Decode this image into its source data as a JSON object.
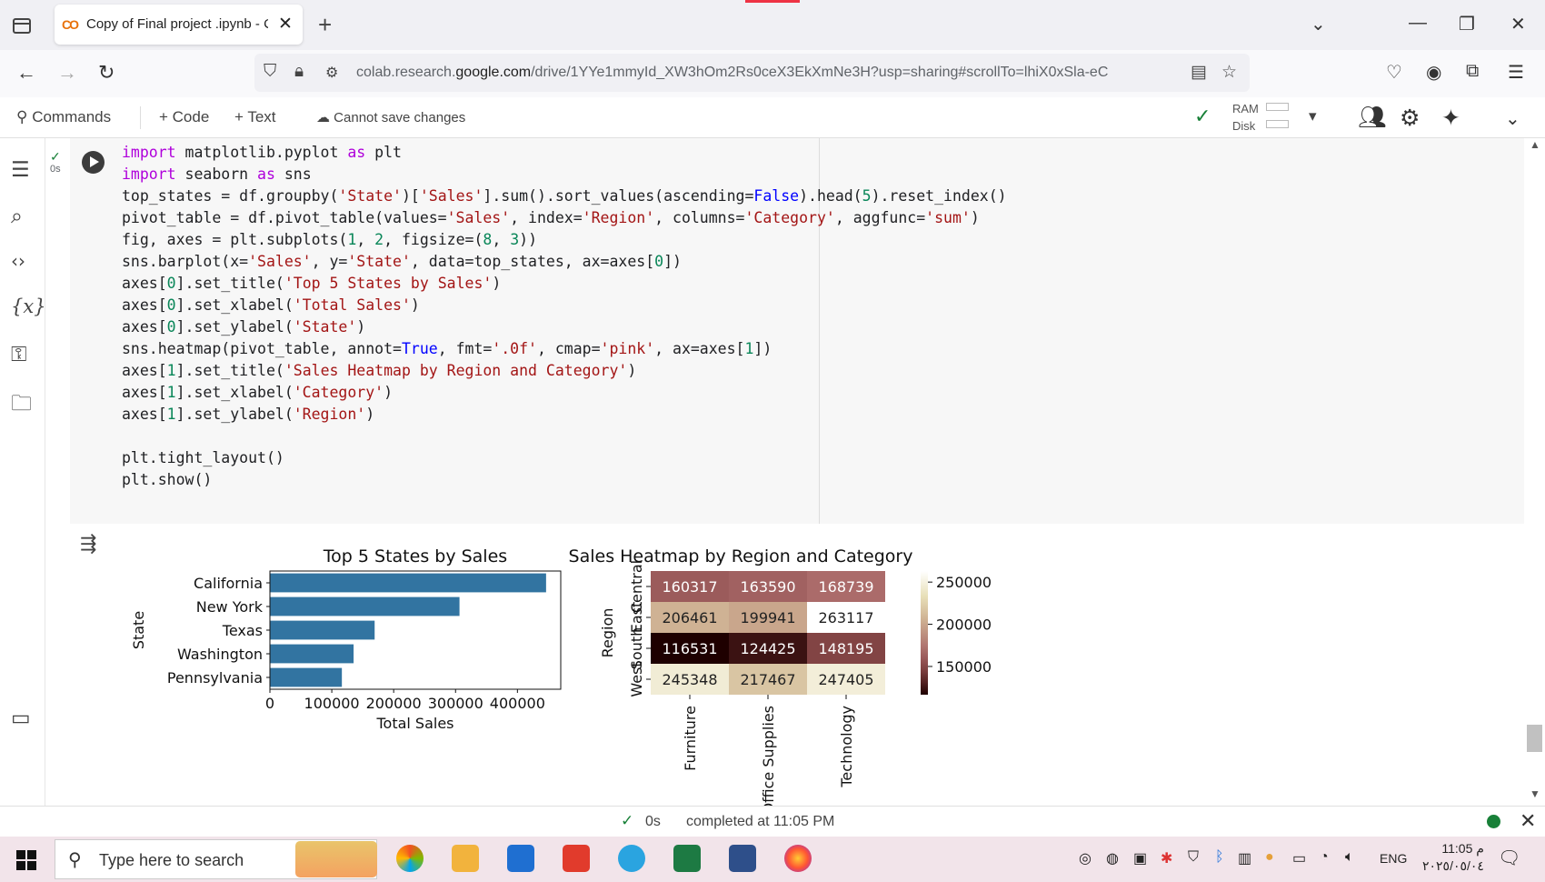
{
  "browser": {
    "tab_title": "Copy of Final project .ipynb - Co",
    "favicon": "CO",
    "url_prefix": "colab.research.",
    "url_domain": "google.com",
    "url_rest": "/drive/1YYe1mmyId_XW3hOm2Rs0ceX3EkXmNe3H?usp=sharing#scrollTo=lhiX0xSla-eC"
  },
  "toolbar": {
    "commands": "Commands",
    "code": "+ Code",
    "text": "+ Text",
    "cannot_save": "Cannot save changes",
    "ram": "RAM",
    "disk": "Disk"
  },
  "cell": {
    "exec_time": "0s",
    "code_lines": [
      "import matplotlib.pyplot as plt",
      "import seaborn as sns",
      "top_states = df.groupby('State')['Sales'].sum().sort_values(ascending=False).head(5).reset_index()",
      "pivot_table = df.pivot_table(values='Sales', index='Region', columns='Category', aggfunc='sum')",
      "fig, axes = plt.subplots(1, 2, figsize=(8, 3))",
      "sns.barplot(x='Sales', y='State', data=top_states, ax=axes[0])",
      "axes[0].set_title('Top 5 States by Sales')",
      "axes[0].set_xlabel('Total Sales')",
      "axes[0].set_ylabel('State')",
      "sns.heatmap(pivot_table, annot=True, fmt='.0f', cmap='pink', ax=axes[1])",
      "axes[1].set_title('Sales Heatmap by Region and Category')",
      "axes[1].set_xlabel('Category')",
      "axes[1].set_ylabel('Region')",
      "",
      "plt.tight_layout()",
      "plt.show()"
    ]
  },
  "chart_data": [
    {
      "type": "bar",
      "orientation": "horizontal",
      "title": "Top 5 States by Sales",
      "xlabel": "Total Sales",
      "ylabel": "State",
      "categories": [
        "California",
        "New York",
        "Texas",
        "Washington",
        "Pennsylvania"
      ],
      "values": [
        446306,
        306361,
        169228,
        135206,
        116276
      ],
      "xlim": [
        0,
        470000
      ],
      "xticks": [
        0,
        100000,
        200000,
        300000,
        400000
      ],
      "color": "#3274a1"
    },
    {
      "type": "heatmap",
      "title": "Sales Heatmap by Region and Category",
      "xlabel": "Category",
      "ylabel": "Region",
      "columns": [
        "Furniture",
        "Office Supplies",
        "Technology"
      ],
      "rows": [
        "Central",
        "East",
        "South",
        "West"
      ],
      "values": [
        [
          160317,
          163590,
          168739
        ],
        [
          206461,
          199941,
          263117
        ],
        [
          116531,
          124425,
          148195
        ],
        [
          245348,
          217467,
          247405
        ]
      ],
      "colorbar_ticks": [
        150000,
        200000,
        250000
      ],
      "cmap": "pink"
    }
  ],
  "status": {
    "time": "0s",
    "text": "completed at 11:05 PM"
  },
  "taskbar": {
    "search_placeholder": "Type here to search",
    "lang": "ENG",
    "time": "11:05 م",
    "date": "٢٠٢٥/٠٥/٠٤"
  }
}
